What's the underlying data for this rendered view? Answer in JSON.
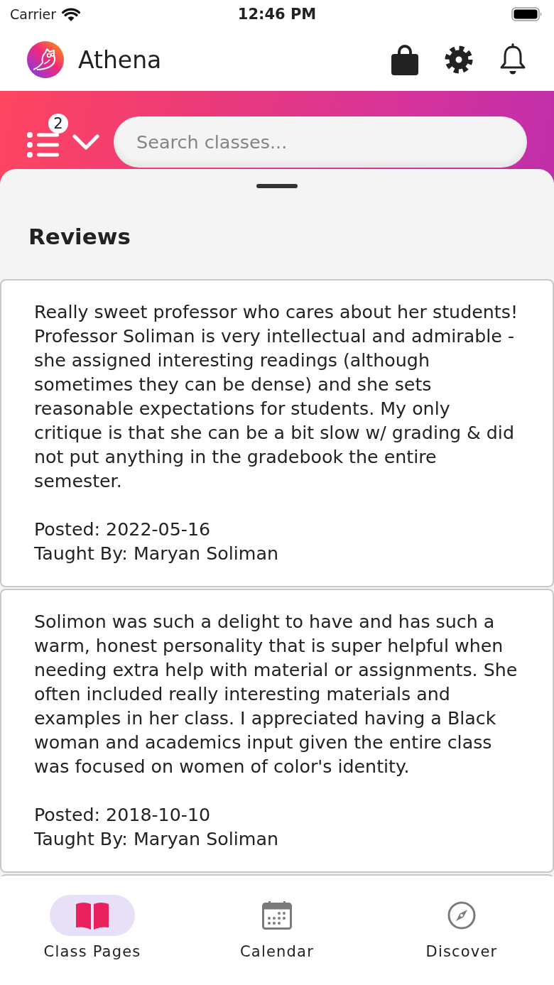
{
  "status_bar": {
    "carrier": "Carrier",
    "time": "12:46 PM"
  },
  "header": {
    "title": "Athena"
  },
  "filter": {
    "count": "2"
  },
  "search": {
    "placeholder": "Search classes..."
  },
  "section": {
    "title": "Reviews"
  },
  "reviews": [
    {
      "text": "Really sweet professor who cares about her students! Professor Soliman is very intellectual and admirable - she assigned interesting readings (although sometimes they can be dense) and she sets reasonable expectations for students. My only critique is that she can be a bit slow w/ grading & did not put anything in the gradebook the entire semester.",
      "posted": "Posted: 2022-05-16",
      "taught_by": "Taught By: Maryan Soliman"
    },
    {
      "text": "Solimon was such a delight to have and has such a warm, honest personality that is super helpful when needing extra help with material or assignments. She often included really interesting materials and examples in her class. I appreciated having a Black woman and academics input given the entire class was focused on women of color's identity.",
      "posted": "Posted: 2018-10-10",
      "taught_by": "Taught By: Maryan Soliman"
    }
  ],
  "tabs": [
    {
      "label": "Class Pages",
      "kind": "book",
      "selected": true
    },
    {
      "label": "Calendar",
      "kind": "calendar",
      "selected": false
    },
    {
      "label": "Discover",
      "kind": "compass",
      "selected": false
    }
  ]
}
